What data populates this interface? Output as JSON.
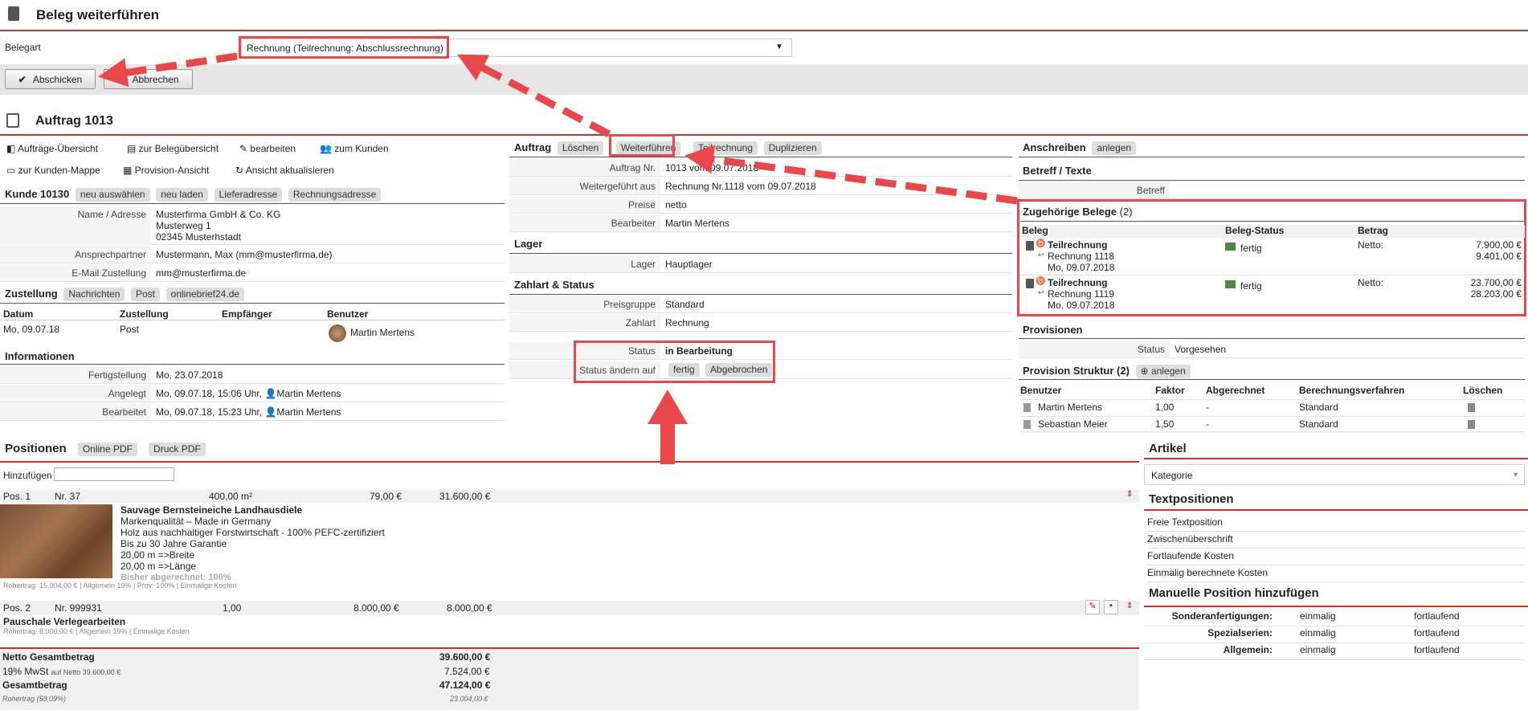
{
  "header": {
    "title": "Beleg weiterführen"
  },
  "belegart": {
    "label": "Belegart",
    "value": "Rechnung (Teilrechnung: Abschlussrechnung)",
    "arrow": "▼"
  },
  "buttons": {
    "submit": "Abschicken",
    "cancel": "Abbrechen"
  },
  "auftrag": {
    "title": "Auftrag 1013",
    "links": [
      "Aufträge-Übersicht",
      "zur Belegübersicht",
      "bearbeiten",
      "zum Kunden",
      "zur Kunden-Mappe",
      "Provision-Ansicht",
      "Ansicht aktualisieren"
    ]
  },
  "kunde": {
    "title": "Kunde 10130",
    "chips": [
      "neu auswählen",
      "neu laden",
      "Lieferadresse",
      "Rechnungsadresse"
    ],
    "name_label": "Name / Adresse",
    "name_lines": [
      "Musterfirma GmbH & Co. KG",
      "Musterweg 1",
      "02345 Musterhstadt"
    ],
    "contact_label": "Ansprechpartner",
    "contact": "Mustermann, Max (mm@musterfirma.de)",
    "email_label": "E-Mail Zustellung",
    "email": "mm@musterfirma.de"
  },
  "zustellung": {
    "title": "Zustellung",
    "chips": [
      "Nachrichten",
      "Post",
      "onlinebrief24.de"
    ],
    "cols": [
      "Datum",
      "Zustellung",
      "Empfänger",
      "Benutzer"
    ],
    "row": {
      "datum": "Mo, 09.07.18",
      "zustellung": "Post",
      "benutzer": "Martin Mertens"
    }
  },
  "info": {
    "title": "Informationen",
    "fertig_label": "Fertigstellung",
    "fertig": "Mo, 23.07.2018",
    "angelegt_label": "Angelegt",
    "angelegt": "Mo, 09.07.18, 15:06 Uhr,",
    "angelegt_user": "Martin Mertens",
    "bearbeitet_label": "Bearbeitet",
    "bearbeitet": "Mo, 09.07.18, 15:23 Uhr,",
    "bearbeitet_user": "Martin Mertens"
  },
  "auftrag_mid": {
    "title": "Auftrag",
    "chips": [
      "Löschen",
      "Weiterführen",
      "Teilrechnung",
      "Duplizieren"
    ],
    "nr_label": "Auftrag Nr.",
    "nr": "1013 vom 09.07.2018",
    "weiter_label": "Weitergeführt aus",
    "weiter": "Rechnung Nr.1118 vom 09.07.2018",
    "preise_label": "Preise",
    "preise": "netto",
    "bearbeiter_label": "Bearbeiter",
    "bearbeiter": "Martin Mertens"
  },
  "lager": {
    "title": "Lager",
    "label": "Lager",
    "value": "Hauptlager"
  },
  "zahlart": {
    "title": "Zahlart & Status",
    "pg_label": "Preisgruppe",
    "pg": "Standard",
    "za_label": "Zahlart",
    "za": "Rechnung",
    "status_label": "Status",
    "status": "in Bearbeitung",
    "change_label": "Status ändern auf",
    "change_chips": [
      "fertig",
      "Abgebrochen"
    ]
  },
  "anschreiben": {
    "title": "Anschreiben",
    "chip": "anlegen",
    "betreff_title": "Betreff / Texte",
    "betreff_label": "Betreff"
  },
  "belege": {
    "title": "Zugehörige Belege",
    "count": "(2)",
    "cols": [
      "Beleg",
      "Beleg-Status",
      "Betrag"
    ],
    "items": [
      {
        "type": "Teilrechnung",
        "ref": "Rechnung 1118",
        "date": "Mo, 09.07.2018",
        "status": "fertig",
        "netto": "Netto:",
        "a1": "7.900,00 €",
        "a2": "9.401,00 €"
      },
      {
        "type": "Teilrechnung",
        "ref": "Rechnung 1119",
        "date": "Mo, 09.07.2018",
        "status": "fertig",
        "netto": "Netto:",
        "a1": "23.700,00 €",
        "a2": "28.203,00 €"
      }
    ]
  },
  "provisionen": {
    "title": "Provisionen",
    "status_label": "Status",
    "status": "Vorgesehen",
    "struktur": "Provision Struktur (2)",
    "anlegen": "anlegen",
    "cols": [
      "Benutzer",
      "Faktor",
      "Abgerechnet",
      "Berechnungsverfahren",
      "Löschen"
    ],
    "rows": [
      {
        "user": "Martin Mertens",
        "faktor": "1,00",
        "abg": "-",
        "verf": "Standard"
      },
      {
        "user": "Sebastian Meier",
        "faktor": "1,50",
        "abg": "-",
        "verf": "Standard"
      }
    ]
  },
  "positionen": {
    "title": "Positionen",
    "chips": [
      "Online PDF",
      "Druck PDF"
    ],
    "add_label": "Hinzufügen",
    "pos1": {
      "pos": "Pos. 1",
      "nr": "Nr. 37",
      "menge": "400,00 m²",
      "preis": "79,00 €",
      "summe": "31.600,00 €",
      "name": "Sauvage Bernsteineiche Landhausdiele",
      "lines": [
        "Markenqualität – Made in Germany",
        "Holz aus nachhaltiger Forstwirtschaft - 100% PEFC-zertifiziert",
        "Bis zu 30 Jahre Garantie",
        "20,00 m =>Breite",
        "20,00 m =>Länge"
      ],
      "abgerechnet": "Bisher abgerechnet: 100%",
      "meta": "Rohertrag: 15.004,00 € | Allgemein 19% | Prov: 100% | Einmalige Kosten"
    },
    "pos2": {
      "pos": "Pos. 2",
      "nr": "Nr. 999931",
      "menge": "1,00",
      "preis": "8.000,00 €",
      "summe": "8.000,00 €",
      "name": "Pauschale Verlegearbeiten",
      "meta": "Rohertrag: 8.000,00 € | Allgemein 19% | Einmalige Kosten"
    },
    "totals": {
      "netto_label": "Netto Gesamtbetrag",
      "netto": "39.600,00 €",
      "mwst_label": "19% MwSt",
      "mwst_sub": "auf Netto 39.600,00 €",
      "mwst": "7.524,00 €",
      "gesamt_label": "Gesamtbetrag",
      "gesamt": "47.124,00 €",
      "roh_label": "Rohertrag (58,09%)",
      "roh": "23.004,00 €"
    }
  },
  "artikel": {
    "title": "Artikel",
    "kategorie": "Kategorie",
    "text_title": "Textpositionen",
    "text_items": [
      "Freie Textposition",
      "Zwischenüberschrift",
      "Fortlaufende Kosten",
      "Einmalig berechnete Kosten"
    ],
    "manuell_title": "Manuelle Position hinzufügen",
    "manuell_rows": [
      {
        "label": "Sonderanfertigungen:",
        "a": "einmalig",
        "b": "fortlaufend"
      },
      {
        "label": "Spezialserien:",
        "a": "einmalig",
        "b": "fortlaufend"
      },
      {
        "label": "Allgemein:",
        "a": "einmalig",
        "b": "fortlaufend"
      }
    ]
  }
}
